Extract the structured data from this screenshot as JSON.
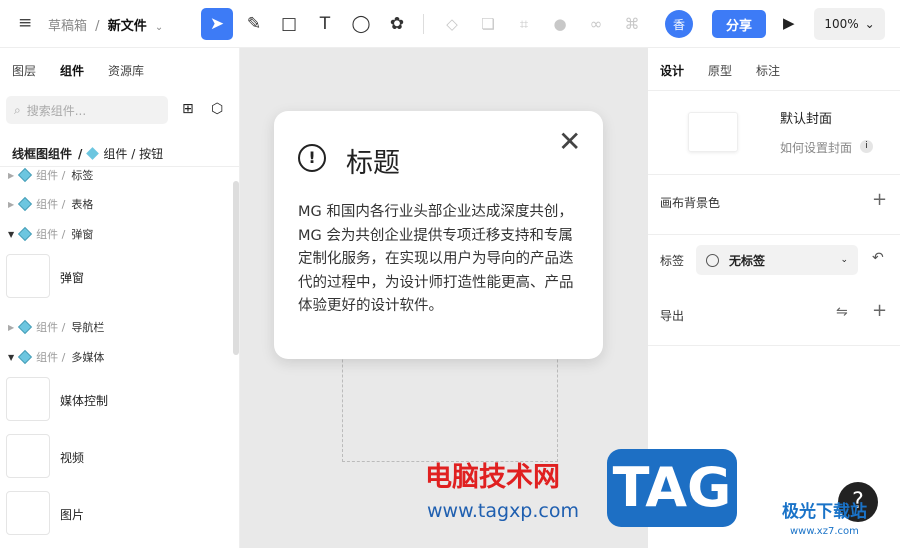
{
  "header": {
    "breadcrumb_parent": "草稿箱",
    "breadcrumb_sep": "/",
    "file_name": "新文件",
    "avatar": "香",
    "share_label": "分享",
    "zoom": "100%"
  },
  "left": {
    "tabs": [
      "图层",
      "组件",
      "资源库"
    ],
    "search_placeholder": "搜索组件...",
    "path_root": "线框图组件",
    "path_sep": "/",
    "path_current": "组件 / 按钮",
    "items": [
      {
        "prefix": "组件 /",
        "name": "标签",
        "expanded": false
      },
      {
        "prefix": "组件 /",
        "name": "表格",
        "expanded": false
      },
      {
        "prefix": "组件 /",
        "name": "弹窗",
        "expanded": true
      },
      {
        "prefix": "组件 /",
        "name": "导航栏",
        "expanded": false
      },
      {
        "prefix": "组件 /",
        "name": "多媒体",
        "expanded": true
      }
    ],
    "components": [
      "弹窗",
      "媒体控制",
      "视频",
      "图片"
    ]
  },
  "dialog": {
    "title": "标题",
    "body": "MG 和国内各行业头部企业达成深度共创，MG 会为共创企业提供专项迁移支持和专属定制化服务，在实现以用户为导向的产品迭代的过程中，为设计师打造性能更高、产品体验更好的设计软件。"
  },
  "right": {
    "tabs": [
      "设计",
      "原型",
      "标注"
    ],
    "cover_title": "默认封面",
    "cover_help": "如何设置封面",
    "bg_label": "画布背景色",
    "tag_label": "标签",
    "tag_value": "无标签",
    "export_label": "导出"
  },
  "watermark": {
    "line1": "电脑技术网",
    "line2": "www.tagxp.com",
    "logo": "TAG",
    "site": "极光下载站",
    "site_url": "www.xz7.com"
  },
  "help": "?"
}
